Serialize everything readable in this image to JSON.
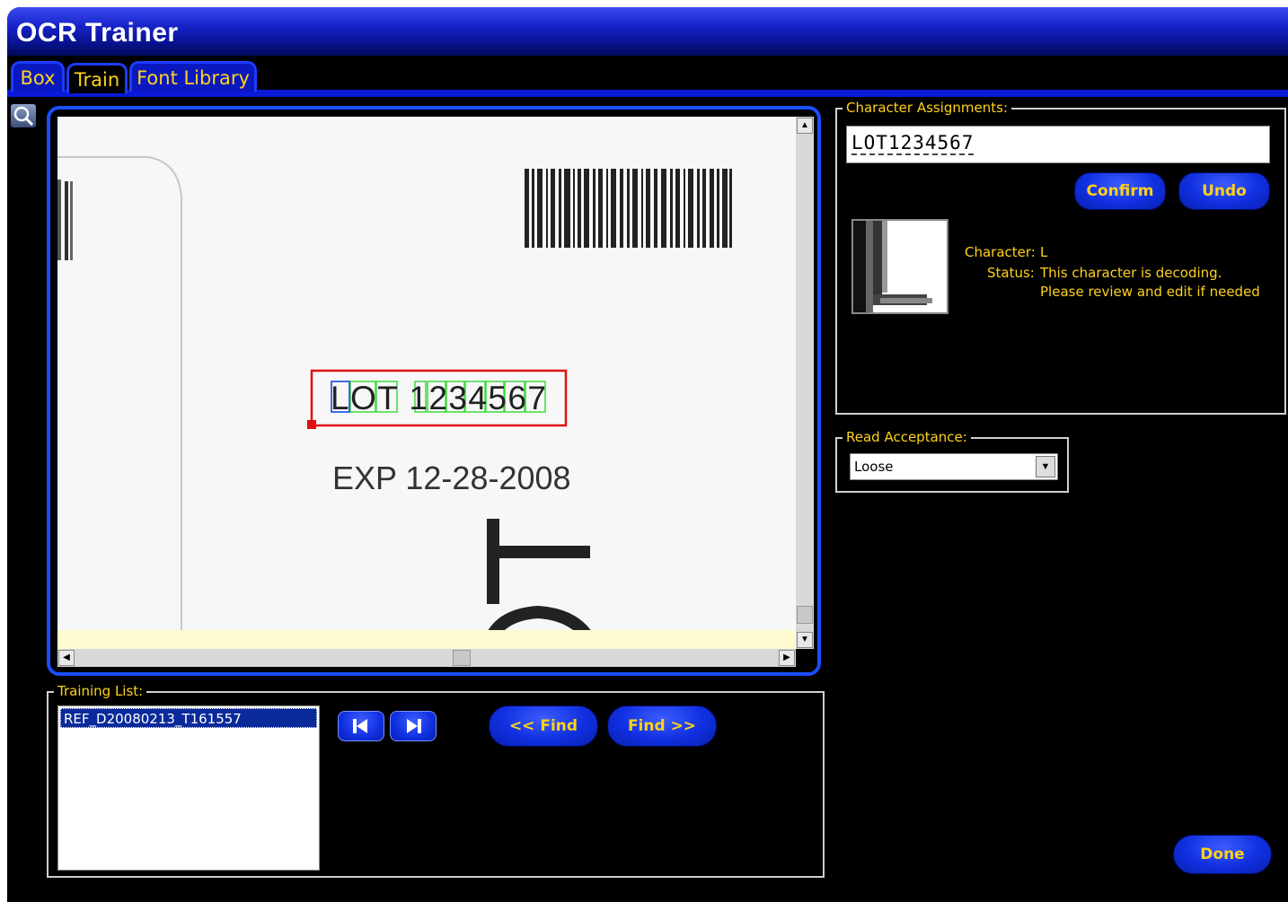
{
  "window": {
    "title": "OCR Trainer"
  },
  "tabs": [
    {
      "label": "Box",
      "active": false
    },
    {
      "label": "Train",
      "active": true
    },
    {
      "label": "Font Library",
      "active": false
    }
  ],
  "image": {
    "roi_text": "LOT 1234567",
    "exp_text": "EXP 12-28-2008"
  },
  "character_assignments": {
    "label": "Character Assignments:",
    "value": "LOT1234567",
    "confirm_label": "Confirm",
    "undo_label": "Undo",
    "character_label": "Character:",
    "character_value": "L",
    "status_label": "Status:",
    "status_line1": "This character is decoding.",
    "status_line2": "Please review and edit if needed"
  },
  "read_acceptance": {
    "label": "Read Acceptance:",
    "selected": "Loose"
  },
  "training_list": {
    "label": "Training List:",
    "items": [
      "REF_D20080213_T161557"
    ]
  },
  "find": {
    "prev_label": "<< Find",
    "next_label": "Find >>"
  },
  "done_label": "Done",
  "colors": {
    "accent_blue": "#1030e0",
    "label_yellow": "#ffd21a",
    "roi_red": "#e01010",
    "char_box_green": "#3ddc3d"
  }
}
